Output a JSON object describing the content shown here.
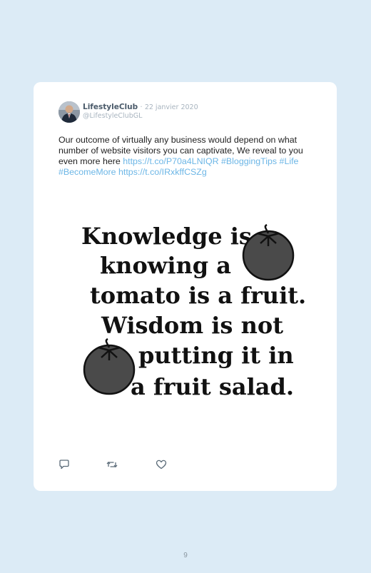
{
  "tweet": {
    "display_name": "LifestyleClub",
    "separator": "·",
    "date": "22 janvier 2020",
    "handle": "@LifestyleClubGL",
    "text_plain": "Our outcome of virtually any business would depend on what number of website visitors you can captivate, We reveal to you even more here",
    "link_1": "https://t.co/P70a4LNIQR",
    "hashtag_1": "#BloggingTips",
    "hashtag_2": "#Life",
    "hashtag_3": "#BecomeMore",
    "link_2": "https://t.co/IRxkffCSZg"
  },
  "image": {
    "line_1": "Knowledge is",
    "line_2": "knowing a",
    "line_3": "tomato is a fruit.",
    "line_4": "Wisdom is not",
    "line_5": "putting it in",
    "line_6": "a fruit salad."
  },
  "actions": {
    "reply_icon": "reply-icon",
    "retweet_icon": "retweet-icon",
    "like_icon": "heart-icon"
  },
  "colors": {
    "page_background": "#dcebf6",
    "card_background": "#ffffff",
    "link": "#6cb6e6",
    "muted": "#a8b4bf"
  },
  "page_number": "9"
}
